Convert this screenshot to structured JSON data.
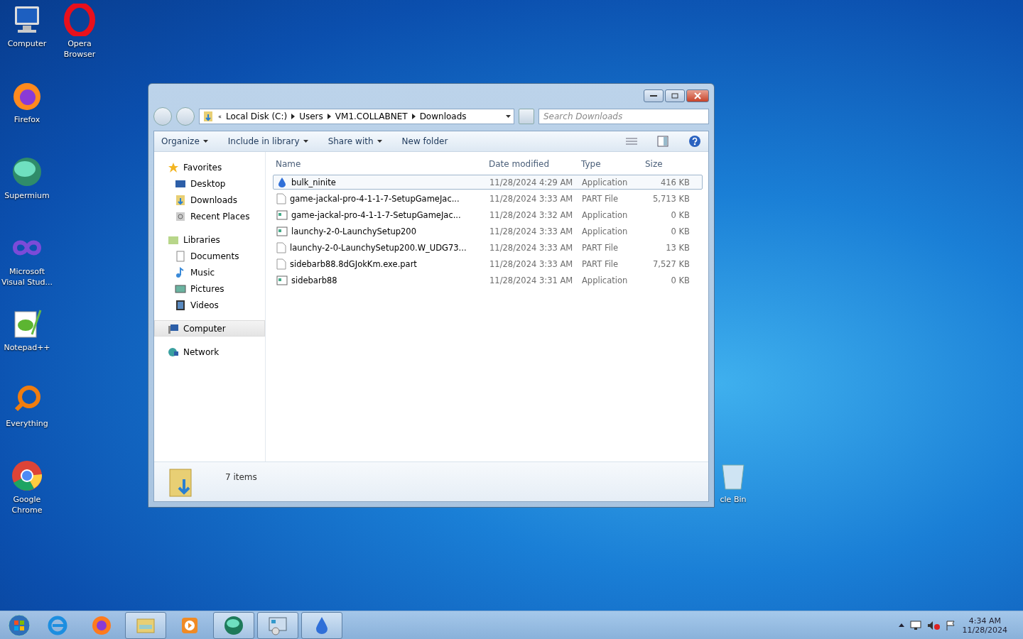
{
  "desktop_icons": [
    {
      "label": "Computer",
      "kind": "computer"
    },
    {
      "label": "Opera Browser",
      "kind": "opera"
    },
    {
      "label": "Firefox",
      "kind": "firefox"
    },
    {
      "label": "Supermium",
      "kind": "supermium"
    },
    {
      "label": "Microsoft Visual Stud...",
      "kind": "vs"
    },
    {
      "label": "Notepad++",
      "kind": "notepad"
    },
    {
      "label": "Everything",
      "kind": "everything"
    },
    {
      "label": "Google Chrome",
      "kind": "chrome"
    },
    {
      "label": "cle Bin",
      "kind": "bin"
    }
  ],
  "window": {
    "address_overflow": "«",
    "address": [
      "Local Disk (C:)",
      "Users",
      "VM1.COLLABNET",
      "Downloads"
    ],
    "search": {
      "placeholder": "Search Downloads"
    },
    "toolbar": [
      {
        "label": "Organize",
        "dropdown": true
      },
      {
        "label": "Include in library",
        "dropdown": true
      },
      {
        "label": "Share with",
        "dropdown": true
      },
      {
        "label": "New folder",
        "dropdown": false
      }
    ],
    "sidebar": [
      {
        "label": "Favorites",
        "kind": "star",
        "selected": false,
        "children": [
          {
            "label": "Desktop",
            "kind": "desktop",
            "selected": false
          },
          {
            "label": "Downloads",
            "kind": "downloads",
            "selected": false
          },
          {
            "label": "Recent Places",
            "kind": "recent",
            "selected": false
          }
        ]
      },
      {
        "label": "Libraries",
        "kind": "library",
        "selected": false,
        "children": [
          {
            "label": "Documents",
            "kind": "doc",
            "selected": false
          },
          {
            "label": "Music",
            "kind": "music",
            "selected": false
          },
          {
            "label": "Pictures",
            "kind": "pictures",
            "selected": false
          },
          {
            "label": "Videos",
            "kind": "videos",
            "selected": false
          }
        ]
      },
      {
        "label": "Computer",
        "kind": "computer",
        "selected": true
      },
      {
        "label": "Network",
        "kind": "network",
        "selected": false
      }
    ],
    "table": {
      "columns": [
        "Name",
        "Date modified",
        "Type",
        "Size"
      ],
      "rows": [
        {
          "kind": "installer",
          "selected": true,
          "cells": [
            "bulk_ninite",
            "11/28/2024 4:29 AM",
            "Application",
            "416 KB"
          ]
        },
        {
          "kind": "blank",
          "selected": false,
          "cells": [
            "game-jackal-pro-4-1-1-7-SetupGameJac...",
            "11/28/2024 3:33 AM",
            "PART File",
            "5,713 KB"
          ]
        },
        {
          "kind": "app",
          "selected": false,
          "cells": [
            "game-jackal-pro-4-1-1-7-SetupGameJac...",
            "11/28/2024 3:32 AM",
            "Application",
            "0 KB"
          ]
        },
        {
          "kind": "app",
          "selected": false,
          "cells": [
            "launchy-2-0-LaunchySetup200",
            "11/28/2024 3:33 AM",
            "Application",
            "0 KB"
          ]
        },
        {
          "kind": "blank",
          "selected": false,
          "cells": [
            "launchy-2-0-LaunchySetup200.W_UDG73...",
            "11/28/2024 3:33 AM",
            "PART File",
            "13 KB"
          ]
        },
        {
          "kind": "blank",
          "selected": false,
          "cells": [
            "sidebarb88.8dGJokKm.exe.part",
            "11/28/2024 3:33 AM",
            "PART File",
            "7,527 KB"
          ]
        },
        {
          "kind": "app",
          "selected": false,
          "cells": [
            "sidebarb88",
            "11/28/2024 3:31 AM",
            "Application",
            "0 KB"
          ]
        }
      ]
    },
    "status_bar": {
      "count": "7 items"
    }
  },
  "taskbar": {
    "items": [
      {
        "kind": "ie",
        "selected": false
      },
      {
        "kind": "firefox",
        "selected": false
      },
      {
        "kind": "explorer",
        "selected": true
      },
      {
        "kind": "media",
        "selected": false
      },
      {
        "kind": "supermium",
        "selected": true
      },
      {
        "kind": "control",
        "selected": true
      },
      {
        "kind": "installer",
        "selected": true
      }
    ],
    "time": "4:34 AM",
    "date": "11/28/2024"
  }
}
